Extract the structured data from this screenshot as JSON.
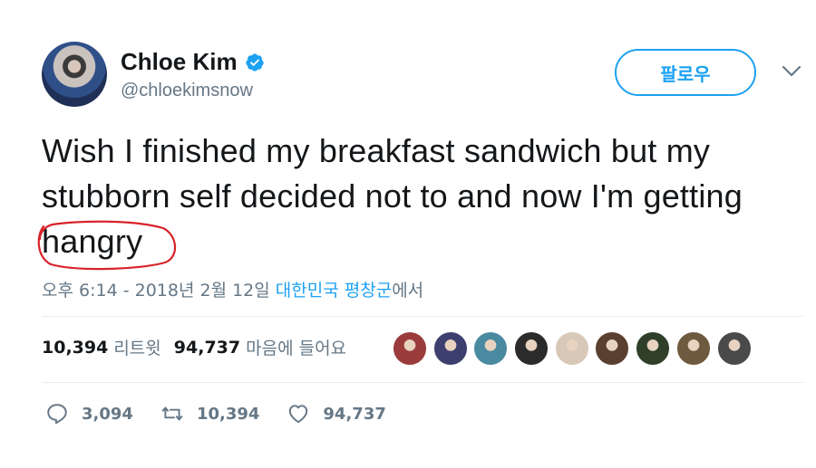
{
  "user": {
    "name": "Chloe Kim",
    "handle": "@chloekimsnow",
    "verified": true
  },
  "follow_label": "팔로우",
  "tweet": {
    "text_before": "Wish I finished my breakfast sandwich but my stubborn self decided not to and now I'm getting ",
    "highlighted_word": "hangry"
  },
  "meta": {
    "time_date": "오후 6:14 - 2018년 2월 12일 ",
    "location": "대한민국 평창군",
    "suffix": "에서"
  },
  "stats": {
    "retweets": "10,394",
    "retweets_label": "리트윗",
    "likes": "94,737",
    "likes_label": "마음에 들어요"
  },
  "actions": {
    "reply_count": "3,094",
    "retweet_count": "10,394",
    "like_count": "94,737"
  },
  "colors": {
    "accent": "#1da1f2",
    "annotation": "#d8232a",
    "secondary_text": "#657786"
  },
  "liker_colors": [
    "#9b3b3b",
    "#3d3f6e",
    "#4a8aa0",
    "#2b2b2b",
    "#d8c8b8",
    "#5a4030",
    "#2f3f2a",
    "#6e5a3e",
    "#4a4a4a"
  ]
}
